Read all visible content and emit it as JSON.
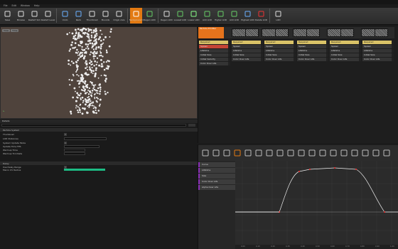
{
  "menu": {
    "items": [
      "File",
      "Edit",
      "Window",
      "Help"
    ]
  },
  "toolbar": {
    "buttons": [
      {
        "label": "Save",
        "icon": "save-icon"
      },
      {
        "label": "Browse",
        "icon": "browse-icon"
      },
      {
        "label": "Restart Sim",
        "icon": "restart-sim-icon"
      },
      {
        "label": "Restart Level",
        "icon": "restart-level-icon"
      },
      {
        "label": "Undo",
        "icon": "undo-icon"
      },
      {
        "label": "Redo",
        "icon": "redo-icon"
      },
      {
        "label": "Thumbnail",
        "icon": "thumbnail-icon"
      },
      {
        "label": "Bounds",
        "icon": "bounds-icon"
      },
      {
        "label": "Origin Axis",
        "icon": "origin-axis-icon"
      },
      {
        "label": "Background Color",
        "icon": "background-color-icon"
      },
      {
        "label": "Regen LOD",
        "icon": "regen-lod-icon"
      },
      {
        "label": "Regen LOD",
        "icon": "regen-lod-icon"
      },
      {
        "label": "Lowest LOD",
        "icon": "lowest-lod-icon"
      },
      {
        "label": "Lower LOD",
        "icon": "lower-lod-icon"
      },
      {
        "label": "Add LOD",
        "icon": "add-lod-icon"
      },
      {
        "label": "Higher LOD",
        "icon": "higher-lod-icon"
      },
      {
        "label": "Add LOD",
        "icon": "add-lod-icon"
      },
      {
        "label": "Highest LOD",
        "icon": "highest-lod-icon"
      },
      {
        "label": "Delete LOD",
        "icon": "delete-lod-icon"
      },
      {
        "label": "LOD",
        "icon": "lod-icon"
      }
    ]
  },
  "viewport": {
    "tabs": [
      "Viewport"
    ],
    "buttons": [
      "View",
      "Time"
    ]
  },
  "details": {
    "header": "Details",
    "rows": [
      {
        "name": "Particle System",
        "category": true
      },
      {
        "name": "Thumbnail",
        "value_width": 0
      },
      {
        "name": "LOD Distances",
        "value_width": 60
      },
      {
        "name": "System Update Mode",
        "value_width": 0
      },
      {
        "name": "Update Time FPS",
        "value_width": 50
      },
      {
        "name": "Warmup Time",
        "value_width": 30
      },
      {
        "name": "Warmup Tick Rate",
        "value_width": 30
      },
      {
        "name": "Delay",
        "category": true
      },
      {
        "name": "Use Delay Range",
        "value_width": 0
      },
      {
        "name": "Macro UV Radius",
        "value_width": 60
      }
    ],
    "delay_section": "Delay"
  },
  "emitters": {
    "first_label": "Particle Emitter",
    "columns": [
      {
        "modules": [
          "Required",
          "Spawn",
          "Lifetime",
          "Initial Size",
          "Initial Velocity",
          "Color Over Life"
        ]
      },
      {
        "modules": [
          "Required",
          "Spawn",
          "Lifetime",
          "Initial Size",
          "Color Over Life"
        ]
      },
      {
        "modules": [
          "Required",
          "Spawn",
          "Lifetime",
          "Initial Size",
          "Color Over Life"
        ]
      },
      {
        "modules": [
          "Required",
          "Spawn",
          "Lifetime",
          "Initial Size",
          "Color Over Life"
        ]
      },
      {
        "modules": [
          "Required",
          "Spawn",
          "Lifetime",
          "Initial Size",
          "Color Over Life"
        ]
      },
      {
        "modules": [
          "Required",
          "Spawn",
          "Lifetime",
          "Initial Size",
          "Color Over Life"
        ]
      }
    ]
  },
  "curve_editor": {
    "tracks": [
      "Curve",
      "Lifetime",
      "Size",
      "Color Over Life",
      "Alpha Over Life"
    ],
    "ticks": [
      "0.00",
      "0.10",
      "0.20",
      "0.30",
      "0.40",
      "0.50",
      "0.60",
      "0.70",
      "0.80",
      "0.90",
      "1.00"
    ]
  },
  "colors": {
    "accent": "#e37a12",
    "track": "#8b2fb8",
    "progress": "#1dbb84"
  }
}
